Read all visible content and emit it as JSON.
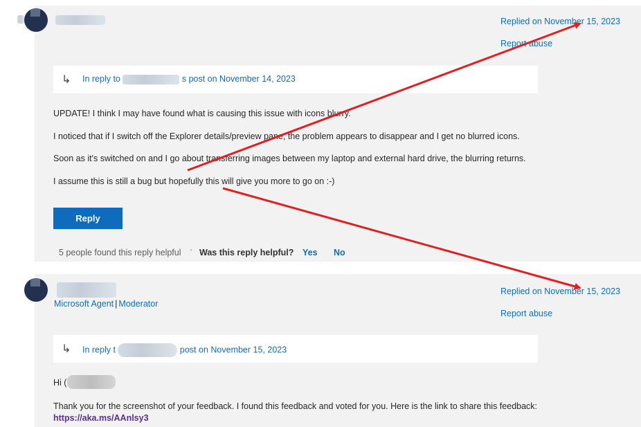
{
  "post1": {
    "replied_label": "Replied on November 15, 2023",
    "report_label": "Report abuse",
    "in_reply_prefix": "In reply to",
    "in_reply_suffix": "s post on November 14, 2023",
    "paragraphs": [
      "UPDATE! I think I may have found what is causing this issue with icons blurry.",
      "I noticed that if I switch off the Explorer details/preview pane, the problem appears to disappear and I get no blurred icons.",
      "Soon as it's switched on and I go about transferring images between my laptop and external hard drive, the blurring returns.",
      "I assume this is still a bug but hopefully this will give you more to go on :-)"
    ],
    "reply_button": "Reply",
    "helpful_count": "5 people found this reply helpful",
    "helpful_separator": "·",
    "helpful_question": "Was this reply helpful?",
    "yes_label": "Yes",
    "no_label": "No"
  },
  "post2": {
    "role_agent": "Microsoft Agent",
    "role_separator": "|",
    "role_moderator": "Moderator",
    "replied_label": "Replied on November 15, 2023",
    "report_label": "Report abuse",
    "in_reply_prefix": "In reply t",
    "in_reply_suffix": " post on November 15, 2023",
    "greeting": "Hi (",
    "body": "Thank you for the screenshot of your feedback. I found this feedback and voted for you. Here is the link to share this feedback:",
    "link": "https://aka.ms/AAnlsy3"
  },
  "colors": {
    "accent": "#0f6cbd",
    "annotation_arrow": "#e02020",
    "card_background": "#f2f2f2",
    "link_visited": "#5c2d91"
  },
  "icons": {
    "reply_indicator": "reply-arrow-icon"
  }
}
